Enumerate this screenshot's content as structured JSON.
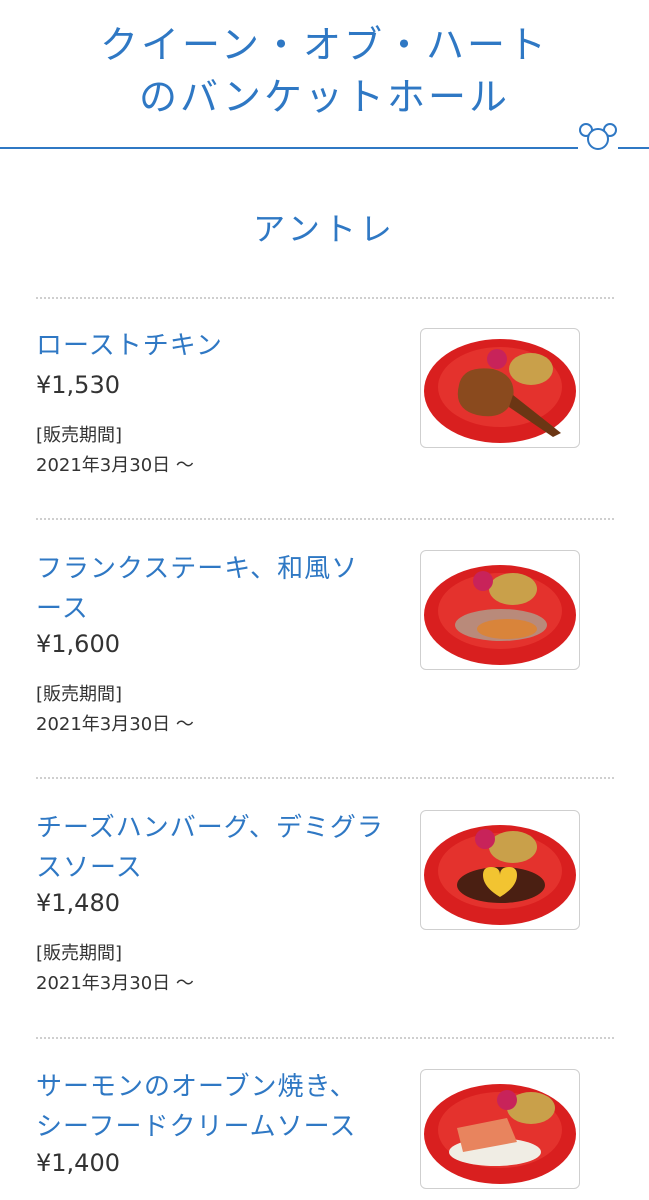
{
  "header": {
    "title_line1": "クイーン・オブ・ハート",
    "title_line2": "のバンケットホール"
  },
  "section": {
    "title": "アントレ"
  },
  "menu": [
    {
      "name_line1": "ローストチキン",
      "name_line2": "",
      "price": "¥1,530",
      "period_label": "[販売期間]",
      "period_value": "2021年3月30日 ～"
    },
    {
      "name_line1": "フランクステーキ、和風ソ",
      "name_line2": "ース",
      "price": "¥1,600",
      "period_label": "[販売期間]",
      "period_value": "2021年3月30日 ～"
    },
    {
      "name_line1": "チーズハンバーグ、デミグラ",
      "name_line2": "スソース",
      "price": "¥1,480",
      "period_label": "[販売期間]",
      "period_value": "2021年3月30日 ～"
    },
    {
      "name_line1": "サーモンのオーブン焼き、",
      "name_line2": "シーフードクリームソース",
      "price": "¥1,400"
    }
  ],
  "colors": {
    "accent": "#2f78c4",
    "plate": "#d91f1f",
    "text": "#333333"
  },
  "icons": {
    "brand": "mickey-icon"
  }
}
